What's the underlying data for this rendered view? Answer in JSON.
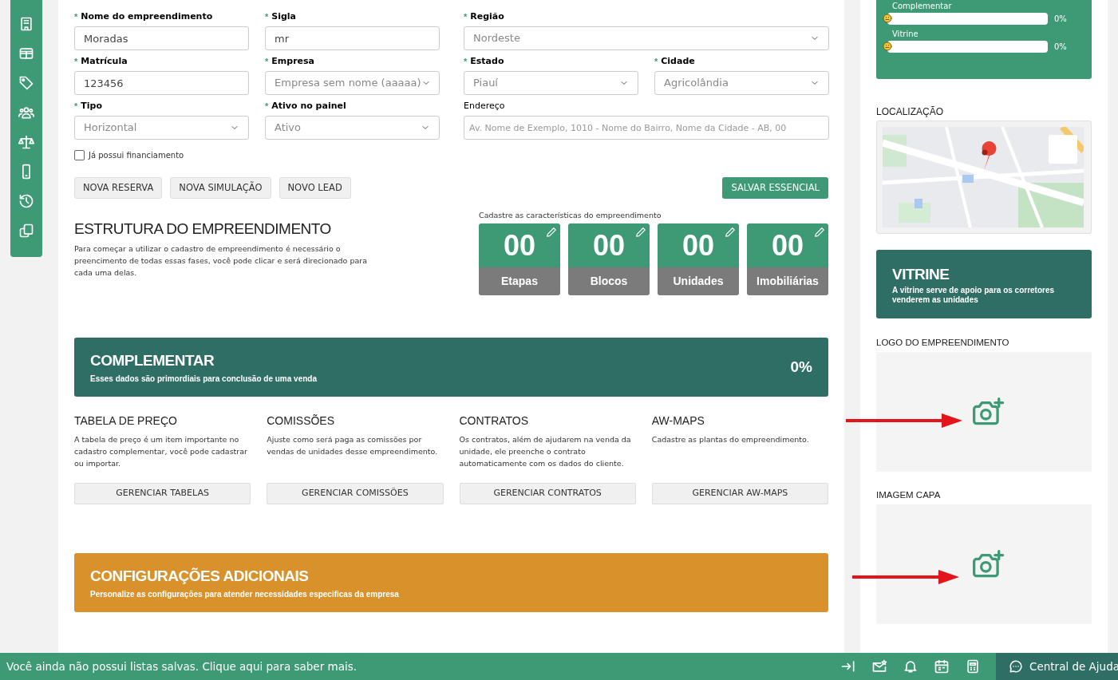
{
  "form": {
    "required_marker": "*",
    "fields": [
      {
        "label": "Nome do empreendimento",
        "required": true,
        "kind": "input",
        "value": "Moradas"
      },
      {
        "label": "Sigla",
        "required": true,
        "kind": "input",
        "value": "mr"
      },
      {
        "label": "Região",
        "required": true,
        "kind": "select",
        "value": "Nordeste"
      },
      {
        "label": "Matrícula",
        "required": true,
        "kind": "input",
        "value": "123456"
      },
      {
        "label": "Empresa",
        "required": true,
        "kind": "select",
        "value": "Empresa sem nome (aaaaa)"
      },
      {
        "label": "Estado",
        "required": true,
        "kind": "select",
        "value": "Piauí"
      },
      {
        "label": "Cidade",
        "required": true,
        "kind": "select",
        "value": "Agricolândia"
      },
      {
        "label": "Tipo",
        "required": true,
        "kind": "select",
        "value": "Horizontal"
      },
      {
        "label": "Ativo no painel",
        "required": true,
        "kind": "select",
        "value": "Ativo"
      },
      {
        "label": "Endereço",
        "required": false,
        "kind": "input",
        "placeholder": "Av. Nome de Exemplo, 1010 - Nome do Bairro, Nome da Cidade - AB, 00"
      }
    ],
    "checkbox": {
      "label": "Já possui financiamento",
      "checked": false
    },
    "actions": [
      "NOVA RESERVA",
      "NOVA SIMULAÇÃO",
      "NOVO LEAD"
    ],
    "save_button": "SALVAR ESSENCIAL"
  },
  "estrutura": {
    "title": "ESTRUTURA DO EMPREENDIMENTO",
    "description": "Para começar a utilizar o cadastro de empreendimento é necessário o preencimento de todas essas fases, você pode clicar e será direcionado para cada uma delas.",
    "prompt": "Cadastre as características do empreendimento",
    "counters": [
      {
        "value": "00",
        "label": "Etapas"
      },
      {
        "value": "00",
        "label": "Blocos"
      },
      {
        "value": "00",
        "label": "Unidades"
      },
      {
        "value": "00",
        "label": "Imobiliárias"
      }
    ]
  },
  "complementar": {
    "title": "COMPLEMENTAR",
    "subtitle": "Esses dados são primordiais para conclusão de uma venda",
    "percent": "0%",
    "sections": [
      {
        "title": "TABELA DE PREÇO",
        "text": "A tabela de preço é um item importante no cadastro complementar, você pode cadastrar ou importar.",
        "button": "GERENCIAR TABELAS"
      },
      {
        "title": "COMISSÕES",
        "text": "Ajuste como será paga as comissões por vendas de unidades desse empreendimento.",
        "button": "GERENCIAR COMISSÕES"
      },
      {
        "title": "CONTRATOS",
        "text": "Os contratos, além de ajudarem na venda da unidade, ele preenche o contrato automaticamente com os dados do cliente.",
        "button": "GERENCIAR CONTRATOS"
      },
      {
        "title": "AW-MAPS",
        "text": "Cadastre as plantas do empreendimento.",
        "button": "GERENCIAR AW-MAPS"
      }
    ]
  },
  "configuracoes": {
    "title": "CONFIGURAÇÕES ADICIONAIS",
    "subtitle": "Personalize as configurações para atender necessidades especificas da empresa"
  },
  "sidebar_right": {
    "progress": [
      {
        "label": "Complementar",
        "level": 0,
        "reading": "0%"
      },
      {
        "label": "Vitrine",
        "level": 0,
        "reading": "0%"
      }
    ],
    "location_title": "LOCALIZAÇÃO",
    "vitrine": {
      "title": "VITRINE",
      "text": "A vitrine serve de apoio para os corretores venderem as unidades"
    },
    "logo_title": "LOGO DO EMPREENDIMENTO",
    "cover_title": "IMAGEM CAPA"
  },
  "status_bar": {
    "message": "Você ainda não possui listas salvas. Clique aqui para saber mais.",
    "help": "Central de Ajuda"
  }
}
